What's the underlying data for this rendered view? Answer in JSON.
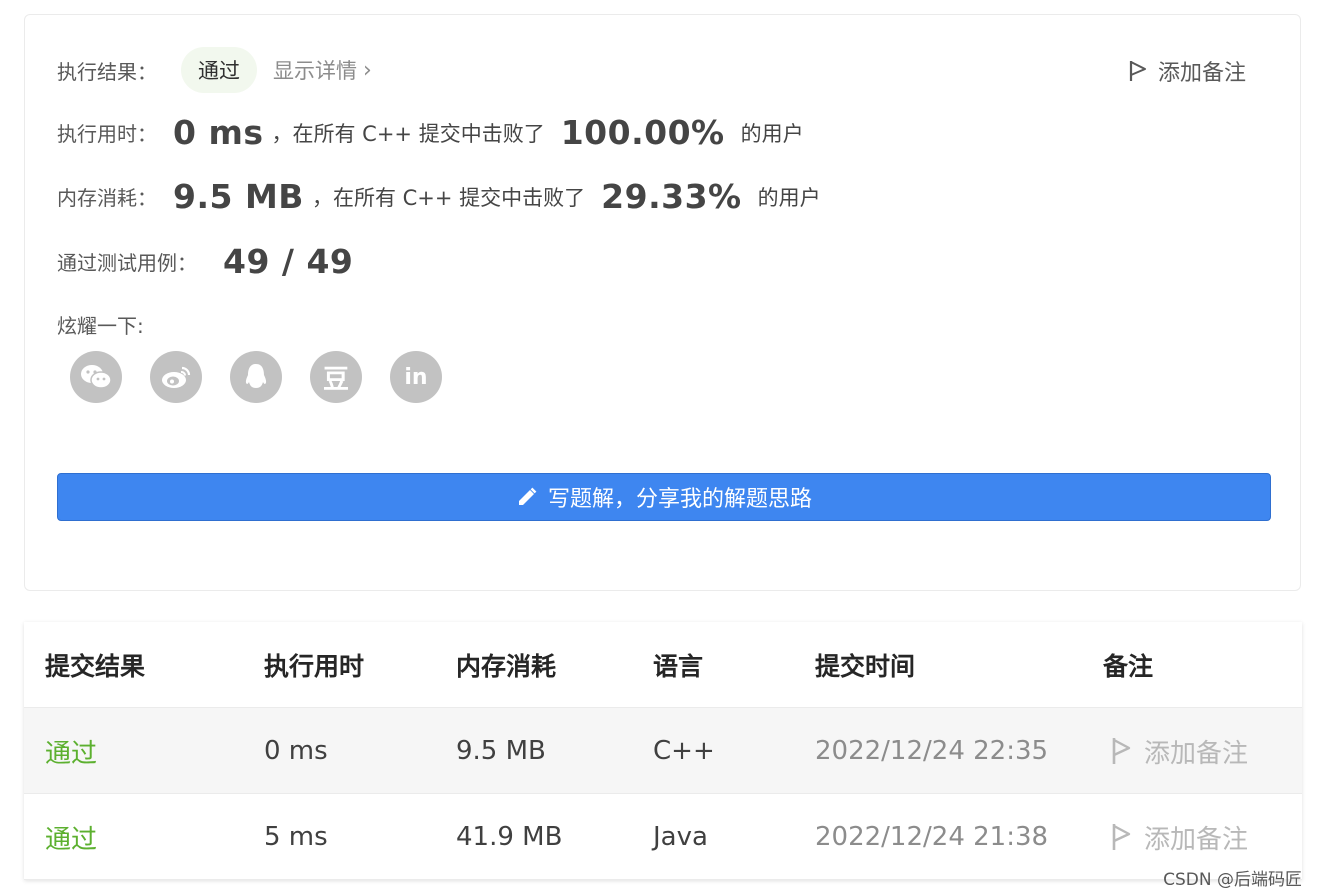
{
  "result": {
    "label": "执行结果：",
    "status": "通过",
    "detail_link": "显示详情",
    "add_note": "添加备注"
  },
  "runtime": {
    "label": "执行用时：",
    "value": "0 ms",
    "mid_text": "，在所有 C++ 提交中击败了",
    "percent": "100.00%",
    "suffix": "的用户"
  },
  "memory": {
    "label": "内存消耗：",
    "value": "9.5 MB",
    "mid_text": "，在所有 C++ 提交中击败了",
    "percent": "29.33%",
    "suffix": "的用户"
  },
  "tests": {
    "label": "通过测试用例：",
    "value": "49 / 49"
  },
  "share": {
    "label": "炫耀一下:",
    "icons": [
      "wechat-icon",
      "weibo-icon",
      "qq-icon",
      "douban-icon",
      "linkedin-icon"
    ],
    "douban_glyph": "豆",
    "linkedin_glyph": "in"
  },
  "write_solution": "写题解，分享我的解题思路",
  "table": {
    "headers": [
      "提交结果",
      "执行用时",
      "内存消耗",
      "语言",
      "提交时间",
      "备注"
    ],
    "rows": [
      {
        "status": "通过",
        "runtime": "0 ms",
        "memory": "9.5 MB",
        "language": "C++",
        "time": "2022/12/24 22:35",
        "note": "添加备注"
      },
      {
        "status": "通过",
        "runtime": "5 ms",
        "memory": "41.9 MB",
        "language": "Java",
        "time": "2022/12/24 21:38",
        "note": "添加备注"
      }
    ]
  },
  "watermark": "CSDN @后端码匠",
  "colors": {
    "accent_blue": "#3e86f0",
    "pass_green": "#5cb02f",
    "pill_bg": "#f2f8ee",
    "share_gray": "#c2c2c2"
  }
}
